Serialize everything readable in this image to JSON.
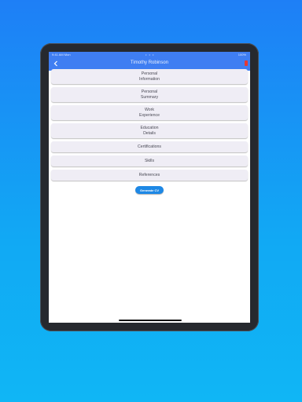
{
  "status": {
    "time": "9:41 AM Mon",
    "dots": "• • •",
    "right": "100%"
  },
  "appbar": {
    "title": "Timothy Robinson"
  },
  "sections": [
    "Personal\nInformation",
    "Personal\nSummary",
    "Work\nExperience",
    "Education\nDetails",
    "Certifications",
    "Skills",
    "References"
  ],
  "actions": {
    "generate_label": "Generate CV"
  },
  "colors": {
    "background_top": "#1e7ff6",
    "background_bottom": "#10b6f5",
    "appbar": "#3f7ef2",
    "button": "#1e88e5",
    "delete": "#e53935"
  },
  "icons": {
    "back": "back-arrow-icon",
    "delete": "delete-icon"
  }
}
